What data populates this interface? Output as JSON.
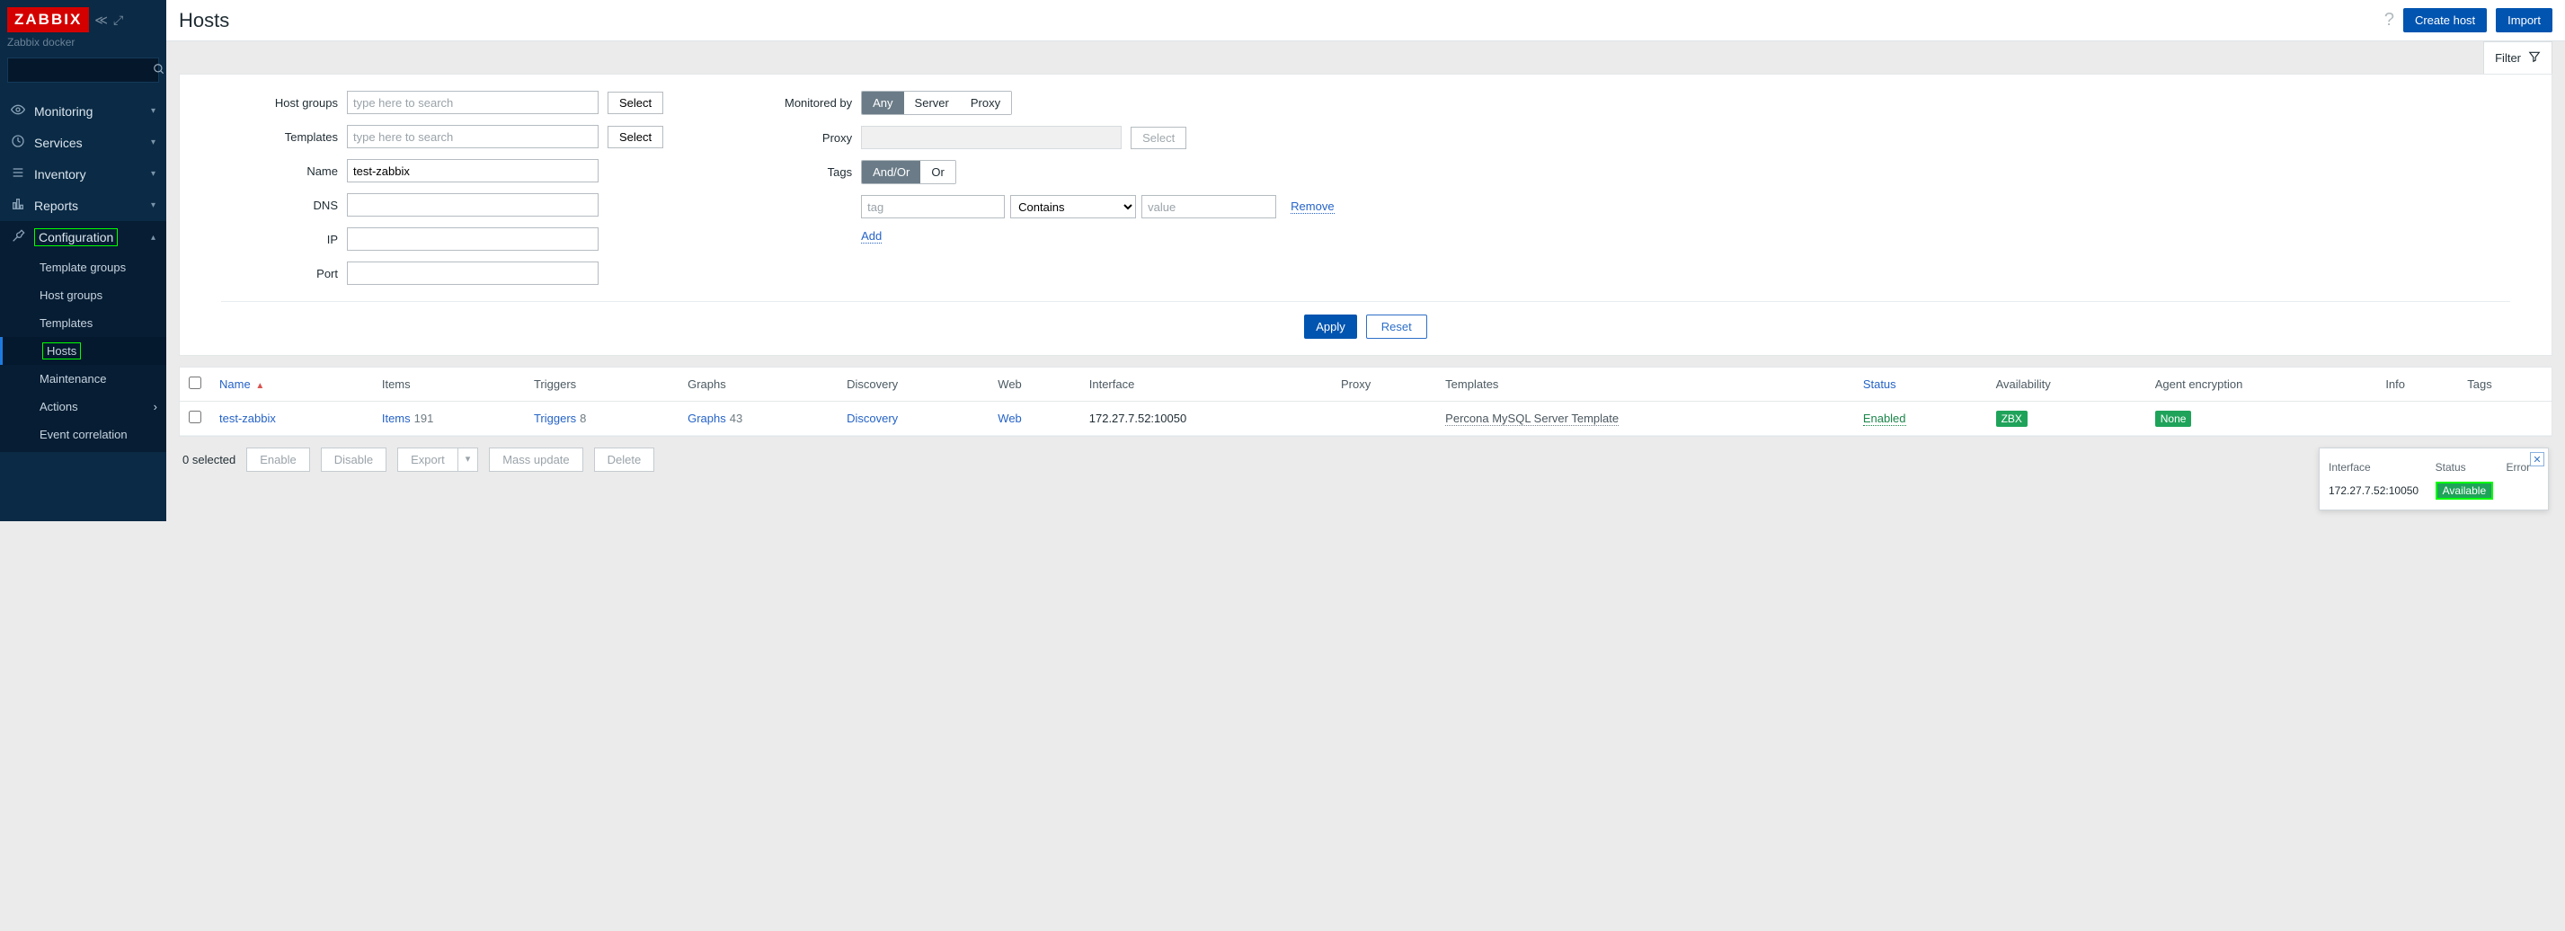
{
  "sidebar": {
    "logo": "ZABBIX",
    "subtitle": "Zabbix docker",
    "nav": [
      {
        "icon": "eye-icon",
        "label": "Monitoring",
        "chev": "down"
      },
      {
        "icon": "gauge-icon",
        "label": "Services",
        "chev": "down"
      },
      {
        "icon": "list-icon",
        "label": "Inventory",
        "chev": "down"
      },
      {
        "icon": "bar-chart-icon",
        "label": "Reports",
        "chev": "down"
      },
      {
        "icon": "wrench-icon",
        "label": "Configuration",
        "chev": "up",
        "active": true,
        "highlighted": true
      }
    ],
    "subnav": [
      {
        "label": "Template groups"
      },
      {
        "label": "Host groups"
      },
      {
        "label": "Templates"
      },
      {
        "label": "Hosts",
        "current": true,
        "highlighted": true
      },
      {
        "label": "Maintenance"
      },
      {
        "label": "Actions",
        "chev": "right"
      },
      {
        "label": "Event correlation"
      }
    ]
  },
  "header": {
    "title": "Hosts",
    "btn_create": "Create host",
    "btn_import": "Import"
  },
  "filter_tab": "Filter",
  "filter": {
    "labels": {
      "host_groups": "Host groups",
      "templates": "Templates",
      "name": "Name",
      "dns": "DNS",
      "ip": "IP",
      "port": "Port",
      "monitored_by": "Monitored by",
      "proxy": "Proxy",
      "tags": "Tags"
    },
    "placeholders": {
      "search": "type here to search",
      "tag": "tag",
      "value": "value"
    },
    "values": {
      "name": "test-zabbix",
      "tag_op": "Contains"
    },
    "select_btn": "Select",
    "monitored_by": [
      "Any",
      "Server",
      "Proxy"
    ],
    "tags_mode": [
      "And/Or",
      "Or"
    ],
    "remove": "Remove",
    "add": "Add",
    "apply": "Apply",
    "reset": "Reset"
  },
  "table": {
    "headers": {
      "name": "Name",
      "items": "Items",
      "triggers": "Triggers",
      "graphs": "Graphs",
      "discovery": "Discovery",
      "web": "Web",
      "interface": "Interface",
      "proxy": "Proxy",
      "templates": "Templates",
      "status": "Status",
      "availability": "Availability",
      "encryption": "Agent encryption",
      "info": "Info",
      "tags": "Tags"
    },
    "row": {
      "name": "test-zabbix",
      "items_label": "Items",
      "items_count": "191",
      "triggers_label": "Triggers",
      "triggers_count": "8",
      "graphs_label": "Graphs",
      "graphs_count": "43",
      "discovery": "Discovery",
      "web": "Web",
      "interface": "172.27.7.52:10050",
      "template": "Percona MySQL Server Template",
      "status": "Enabled",
      "availability": "ZBX",
      "encryption": "None"
    }
  },
  "bulkbar": {
    "selected": "0 selected",
    "enable": "Enable",
    "disable": "Disable",
    "export": "Export",
    "mass_update": "Mass update",
    "delete": "Delete"
  },
  "avail_popup": {
    "h_interface": "Interface",
    "h_status": "Status",
    "h_error": "Error",
    "interface": "172.27.7.52:10050",
    "status": "Available"
  }
}
